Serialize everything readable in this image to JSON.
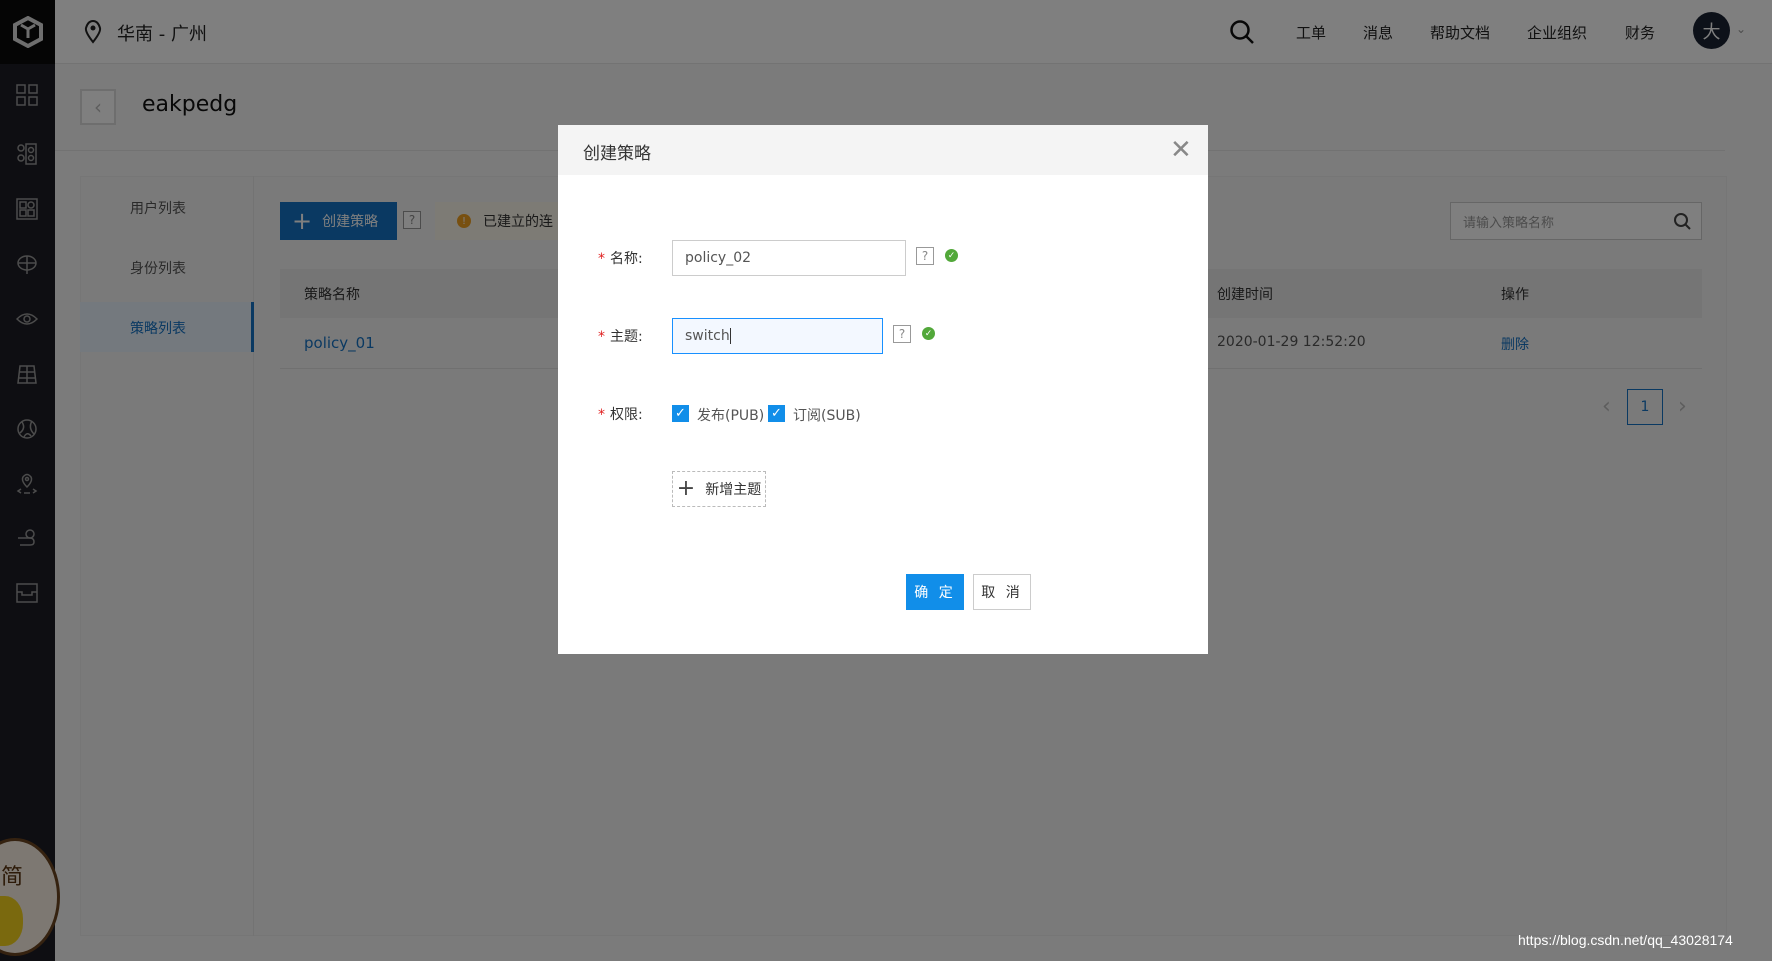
{
  "header": {
    "region": "华南 - 广州",
    "nav": [
      "工单",
      "消息",
      "帮助文档",
      "企业组织",
      "财务"
    ],
    "avatar_text": "大"
  },
  "page": {
    "title": "eakpedg",
    "left_nav": [
      {
        "label": "用户列表",
        "active": false
      },
      {
        "label": "身份列表",
        "active": false
      },
      {
        "label": "策略列表",
        "active": true
      }
    ],
    "create_button": "创建策略",
    "help": "?",
    "warning": "已建立的连",
    "search_placeholder": "请输入策略名称",
    "table": {
      "headers": [
        "策略名称",
        "创建时间",
        "操作"
      ],
      "rows": [
        {
          "name": "policy_01",
          "created": "2020-01-29 12:52:20",
          "action": "删除"
        }
      ]
    },
    "pagination": {
      "current": "1"
    }
  },
  "dialog": {
    "title": "创建策略",
    "required": "*",
    "name_label": "名称:",
    "name_value": "policy_02",
    "topic_label": "主题:",
    "topic_value": "switch",
    "permission_label": "权限:",
    "pub_label": "发布(PUB)",
    "pub_checked": true,
    "sub_label": "订阅(SUB)",
    "sub_checked": true,
    "add_topic": "新增主题",
    "confirm": "确 定",
    "cancel": "取 消"
  },
  "colors": {
    "primary": "#118ee9",
    "nav_blue": "#1572c4",
    "success": "#52a83a",
    "required": "#e02020"
  },
  "watermark": "https://blog.csdn.net/qq_43028174"
}
